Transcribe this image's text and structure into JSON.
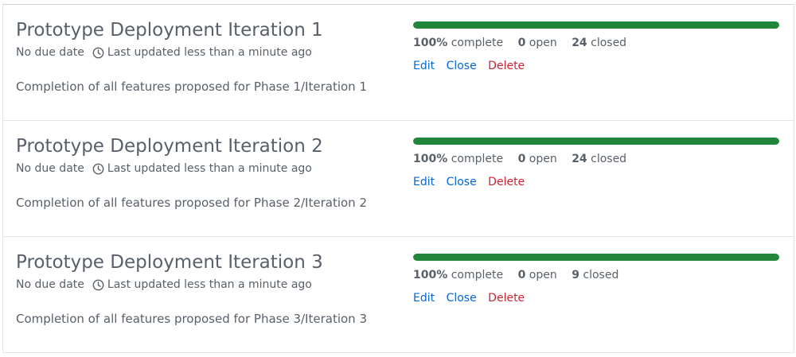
{
  "milestones": [
    {
      "title": "Prototype Deployment Iteration 1",
      "due": "No due date",
      "updated": "Last updated less than a minute ago",
      "description": "Completion of all features proposed for Phase 1/Iteration 1",
      "progress_percent": 100,
      "percent_label": "100%",
      "complete_label": "complete",
      "open_count": "0",
      "open_label": "open",
      "closed_count": "24",
      "closed_label": "closed",
      "actions": {
        "edit": "Edit",
        "close": "Close",
        "delete": "Delete"
      }
    },
    {
      "title": "Prototype Deployment Iteration 2",
      "due": "No due date",
      "updated": "Last updated less than a minute ago",
      "description": "Completion of all features proposed for Phase 2/Iteration 2",
      "progress_percent": 100,
      "percent_label": "100%",
      "complete_label": "complete",
      "open_count": "0",
      "open_label": "open",
      "closed_count": "24",
      "closed_label": "closed",
      "actions": {
        "edit": "Edit",
        "close": "Close",
        "delete": "Delete"
      }
    },
    {
      "title": "Prototype Deployment Iteration 3",
      "due": "No due date",
      "updated": "Last updated less than a minute ago",
      "description": "Completion of all features proposed for Phase 3/Iteration 3",
      "progress_percent": 100,
      "percent_label": "100%",
      "complete_label": "complete",
      "open_count": "0",
      "open_label": "open",
      "closed_count": "9",
      "closed_label": "closed",
      "actions": {
        "edit": "Edit",
        "close": "Close",
        "delete": "Delete"
      }
    }
  ],
  "colors": {
    "progress": "#22863a",
    "link": "#0366d6",
    "danger": "#cb2431",
    "text": "#586069"
  },
  "icons": {
    "updated": "clock-icon"
  }
}
